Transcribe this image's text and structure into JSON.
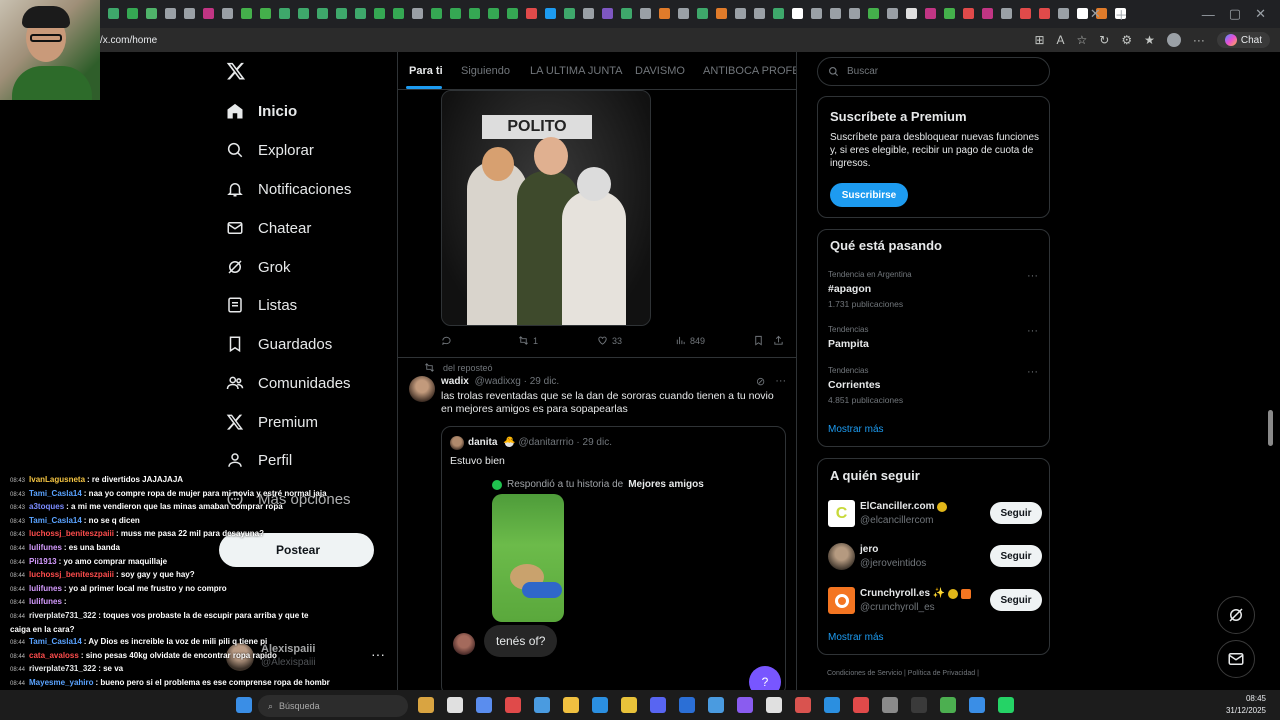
{
  "browser": {
    "url": "/x.com/home",
    "copilot_label": "Chat",
    "new_tab_icon": "plus-icon",
    "tab_colors": [
      "#3ea86b",
      "#35a853",
      "#4fb36a",
      "#9aa0a6",
      "#9aa0a6",
      "#c13584",
      "#9aa0a6",
      "#44b04b",
      "#44b04b",
      "#3ea86b",
      "#3ea86b",
      "#3ea86b",
      "#3ea86b",
      "#3ea86b",
      "#35a853",
      "#35a853",
      "#9aa0a6",
      "#35a853",
      "#35a853",
      "#35a853",
      "#35a853",
      "#35a853",
      "#e04a4a",
      "#1d9bf0",
      "#3ea86b",
      "#9aa0a6",
      "#7e57c2",
      "#3ea86b",
      "#9aa0a6",
      "#e07b2a",
      "#9aa0a6",
      "#3ea86b",
      "#e07b2a",
      "#9aa0a6",
      "#9aa0a6",
      "#3ea86b",
      "#ffffff",
      "#9aa0a6",
      "#9aa0a6",
      "#9aa0a6",
      "#44b04b",
      "#9aa0a6",
      "#e0e0e0",
      "#c13584",
      "#44b04b",
      "#e04a4a",
      "#c13584",
      "#9aa0a6",
      "#e04a4a",
      "#e04a4a",
      "#9aa0a6",
      "#ffffff",
      "#e07b2a",
      "#ffffff"
    ]
  },
  "nav": {
    "logo_icon": "x-logo-icon",
    "items": [
      {
        "label": "Inicio",
        "icon": "home-icon"
      },
      {
        "label": "Explorar",
        "icon": "search-icon"
      },
      {
        "label": "Notificaciones",
        "icon": "bell-icon"
      },
      {
        "label": "Chatear",
        "icon": "mail-icon"
      },
      {
        "label": "Grok",
        "icon": "grok-icon"
      },
      {
        "label": "Listas",
        "icon": "list-icon"
      },
      {
        "label": "Guardados",
        "icon": "bookmark-icon"
      },
      {
        "label": "Comunidades",
        "icon": "people-icon"
      },
      {
        "label": "Premium",
        "icon": "x-logo-icon"
      },
      {
        "label": "Perfil",
        "icon": "person-icon"
      },
      {
        "label": "Más opciones",
        "icon": "more-circle-icon"
      }
    ],
    "post_button": "Postear"
  },
  "account": {
    "name": "Alexispaiii",
    "handle": "@Alexispaiii",
    "more": "···"
  },
  "chat_overlay": {
    "messages": [
      {
        "time": "08:43",
        "user": "IvanLagusneta",
        "color": "#f5c542",
        "text": ": re divertidos JAJAJAJA"
      },
      {
        "time": "08:43",
        "user": "Tami_Casla14",
        "color": "#5aa3ff",
        "text": ": naa yo compre ropa de mujer para mi novia y estré normal jaja"
      },
      {
        "time": "08:43",
        "user": "a3toques",
        "color": "#7b8cff",
        "text": ": a mi me vendieron que las minas amaban comprar ropa"
      },
      {
        "time": "08:43",
        "user": "Tami_Casla14",
        "color": "#5aa3ff",
        "text": ": no se q dicen"
      },
      {
        "time": "08:43",
        "user": "luchossj_beniteszpaiii",
        "color": "#ff4d4d",
        "text": ": muss me pasa 22 mil para desayuna?"
      },
      {
        "time": "08:44",
        "user": "lulifunes",
        "color": "#d59bff",
        "text": ": es una banda"
      },
      {
        "time": "08:44",
        "user": "Pii1913",
        "color": "#d59bff",
        "text": ": yo amo comprar maquillaje"
      },
      {
        "time": "08:44",
        "user": "luchossj_beniteszpaiii",
        "color": "#ff4d4d",
        "text": ": soy gay y que hay?"
      },
      {
        "time": "08:44",
        "user": "lulifunes",
        "color": "#d59bff",
        "text": ": yo al primer local me frustro y no compro"
      },
      {
        "time": "08:44",
        "user": "lulifunes",
        "color": "#d59bff",
        "text": ": "
      },
      {
        "time": "08:44",
        "user": "riverplate731_322",
        "color": "#e7e9ea",
        "text": ": toques vos probaste la de escupir para arriba y que te"
      },
      {
        "time": "",
        "user": "",
        "color": "#e7e9ea",
        "text": "caiga en la cara?"
      },
      {
        "time": "08:44",
        "user": "Tami_Casla14",
        "color": "#5aa3ff",
        "text": ": Ay Dios es increible la voz de mili pili q tiene pi"
      },
      {
        "time": "08:44",
        "user": "cata_avaloss",
        "color": "#ff4d4d",
        "text": ": sino pesas 40kg olvidate de encontrar ropa rapido"
      },
      {
        "time": "08:44",
        "user": "riverplate731_322",
        "color": "#e7e9ea",
        "text": ": se va"
      },
      {
        "time": "08:44",
        "user": "Mayesme_yahiro",
        "color": "#5aa3ff",
        "text": ": bueno pero si el problema es ese comprense ropa de hombre"
      }
    ]
  },
  "timeline": {
    "tabs": [
      {
        "label": "Para ti",
        "active": true
      },
      {
        "label": "Siguiendo",
        "active": false
      },
      {
        "label": "LA ULTIMA JUNTA",
        "active": false
      },
      {
        "label": "DAVISMO",
        "active": false
      },
      {
        "label": "ANTIBOCA PROFESI",
        "active": false
      }
    ],
    "post1": {
      "image_sign": "POLITO",
      "replies": "",
      "reposts": "1",
      "likes": "33",
      "views": "849"
    },
    "post2": {
      "repost_label": "del reposteó",
      "name": "wadix",
      "handle": "@wadixxg",
      "date": "· 29 dic.",
      "text": "las trolas reventadas que se la dan de sororas cuando tienen a tu novio en mejores amigos es para sopapearlas",
      "quote": {
        "name": "danita",
        "emoji": "🐣",
        "handle": "@danitarrrio",
        "date": "· 29 dic.",
        "text": "Estuvo bien",
        "story_prefix": "Respondió a tu historia de",
        "story_bold": "Mejores amigos",
        "reply_text": "tenés of?"
      }
    },
    "grok_fab": "?"
  },
  "sidebar": {
    "search_placeholder": "Buscar",
    "premium": {
      "title": "Suscríbete a Premium",
      "text": "Suscríbete para desbloquear nuevas funciones y, si eres elegible, recibir un pago de cuota de ingresos.",
      "button": "Suscribirse"
    },
    "trends": {
      "title": "Qué está pasando",
      "items": [
        {
          "context": "Tendencia en Argentina",
          "name": "#apagon",
          "count": "1.731 publicaciones"
        },
        {
          "context": "Tendencias",
          "name": "Pampita",
          "count": ""
        },
        {
          "context": "Tendencias",
          "name": "Corrientes",
          "count": "4.851 publicaciones"
        }
      ],
      "show_more": "Mostrar más"
    },
    "who_to_follow": {
      "title": "A quién seguir",
      "accounts": [
        {
          "name": "ElCanciller.com",
          "handle": "@elcancillercom",
          "button": "Seguir",
          "avatar_color": "#ffffff"
        },
        {
          "name": "jero",
          "handle": "@jeroveintidos",
          "button": "Seguir",
          "avatar_color": "#8a7a6a"
        },
        {
          "name": "Crunchyroll.es ✨",
          "handle": "@crunchyroll_es",
          "button": "Seguir",
          "avatar_color": "#f47521"
        }
      ],
      "show_more": "Mostrar más"
    },
    "footer": "Condiciones de Servicio  |  Política de Privacidad  |"
  },
  "taskbar": {
    "search_placeholder": "Búsqueda",
    "time": "08:45",
    "date": "31/12/2025"
  }
}
